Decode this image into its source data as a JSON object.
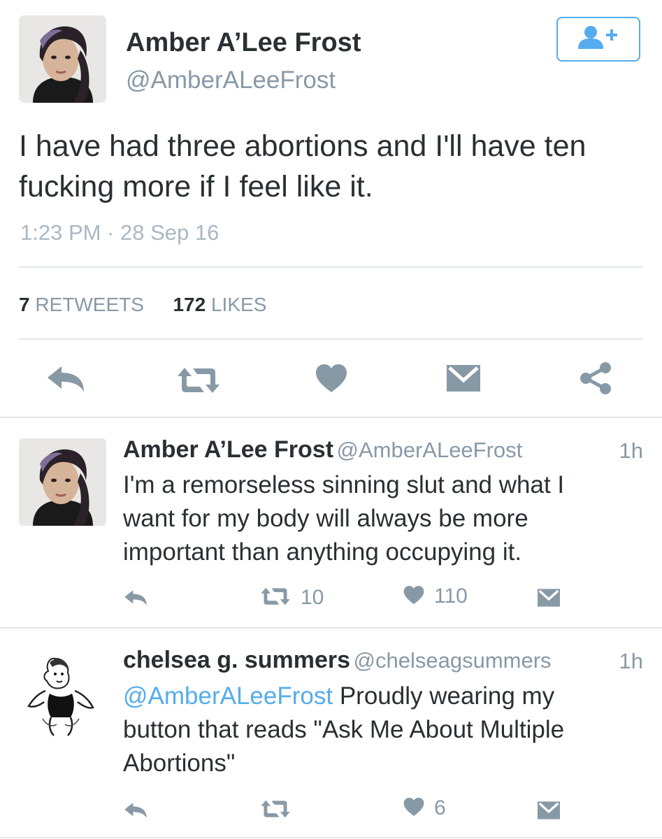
{
  "main_tweet": {
    "name": "Amber A’Lee Frost",
    "handle": "@AmberALeeFrost",
    "text_line1": "I have had three abortions and I'll have ten",
    "text_line2": "fucking more if I feel like it.",
    "timestamp": "1:23 PM · 28 Sep 16",
    "retweets_count": "7",
    "retweets_label": "RETWEETS",
    "likes_count": "172",
    "likes_label": "LIKES"
  },
  "replies": [
    {
      "name": "Amber A’Lee Frost",
      "handle": "@AmberALeeFrost",
      "time": "1h",
      "text_lines": [
        "I'm a remorseless sinning slut and what I",
        "want for my body will always be more",
        "important than anything occupying it."
      ],
      "retweets": "10",
      "likes": "110"
    },
    {
      "name": "chelsea g. summers",
      "handle": "@chelseagsummers",
      "time": "1h",
      "mention": "@AmberALeeFrost",
      "text_line1_rest": " Proudly wearing my",
      "text_lines_rest": [
        "button that reads \"Ask Me About Multiple",
        "Abortions\""
      ],
      "retweets": "",
      "likes": "6"
    }
  ],
  "icons": {
    "follow": "follow-user-icon",
    "reply": "reply-icon",
    "retweet": "retweet-icon",
    "like": "heart-icon",
    "message": "envelope-icon",
    "share": "share-icon"
  },
  "colors": {
    "accent": "#55acee",
    "icon_gray": "#8899a6",
    "text": "#292f33",
    "divider": "#e1e8ed"
  }
}
